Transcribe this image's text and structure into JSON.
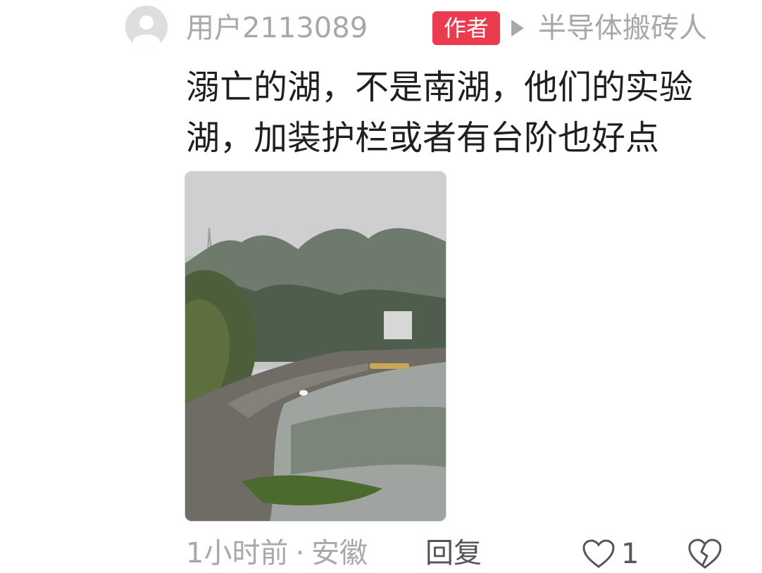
{
  "comment": {
    "username": "用户2113089",
    "author_badge": "作者",
    "reply_to": "半导体搬砖人",
    "text": "溺亡的湖，不是南湖，他们的实验湖，加装护栏或者有台阶也好点",
    "image_icon": "lake-photo",
    "time": "1小时前",
    "separator": "·",
    "location": "安徽",
    "reply_label": "回复",
    "like_count": "1",
    "colors": {
      "badge": "#ea3b4f",
      "muted_text": "#a8a8a8"
    },
    "icons": {
      "avatar": "default-user-avatar",
      "reply_arrow": "triangle-right-icon",
      "like": "heart-outline-icon",
      "dislike": "broken-heart-icon"
    }
  }
}
